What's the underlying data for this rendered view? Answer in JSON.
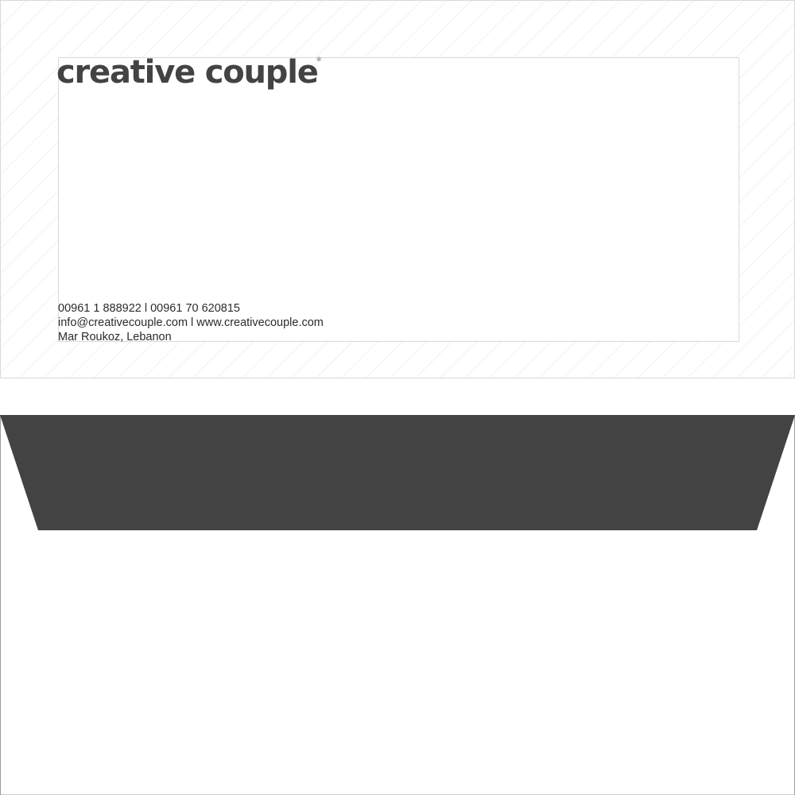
{
  "brand": {
    "name": "creative couple",
    "registered_mark": "®",
    "color": "#434343"
  },
  "contact": {
    "phone_line": "00961 1 888922 l 00961 70 620815",
    "web_line": "info@creativecouple.com l www.creativecouple.com",
    "address_line": "Mar Roukoz, Lebanon"
  },
  "flap": {
    "color": "#434343"
  }
}
